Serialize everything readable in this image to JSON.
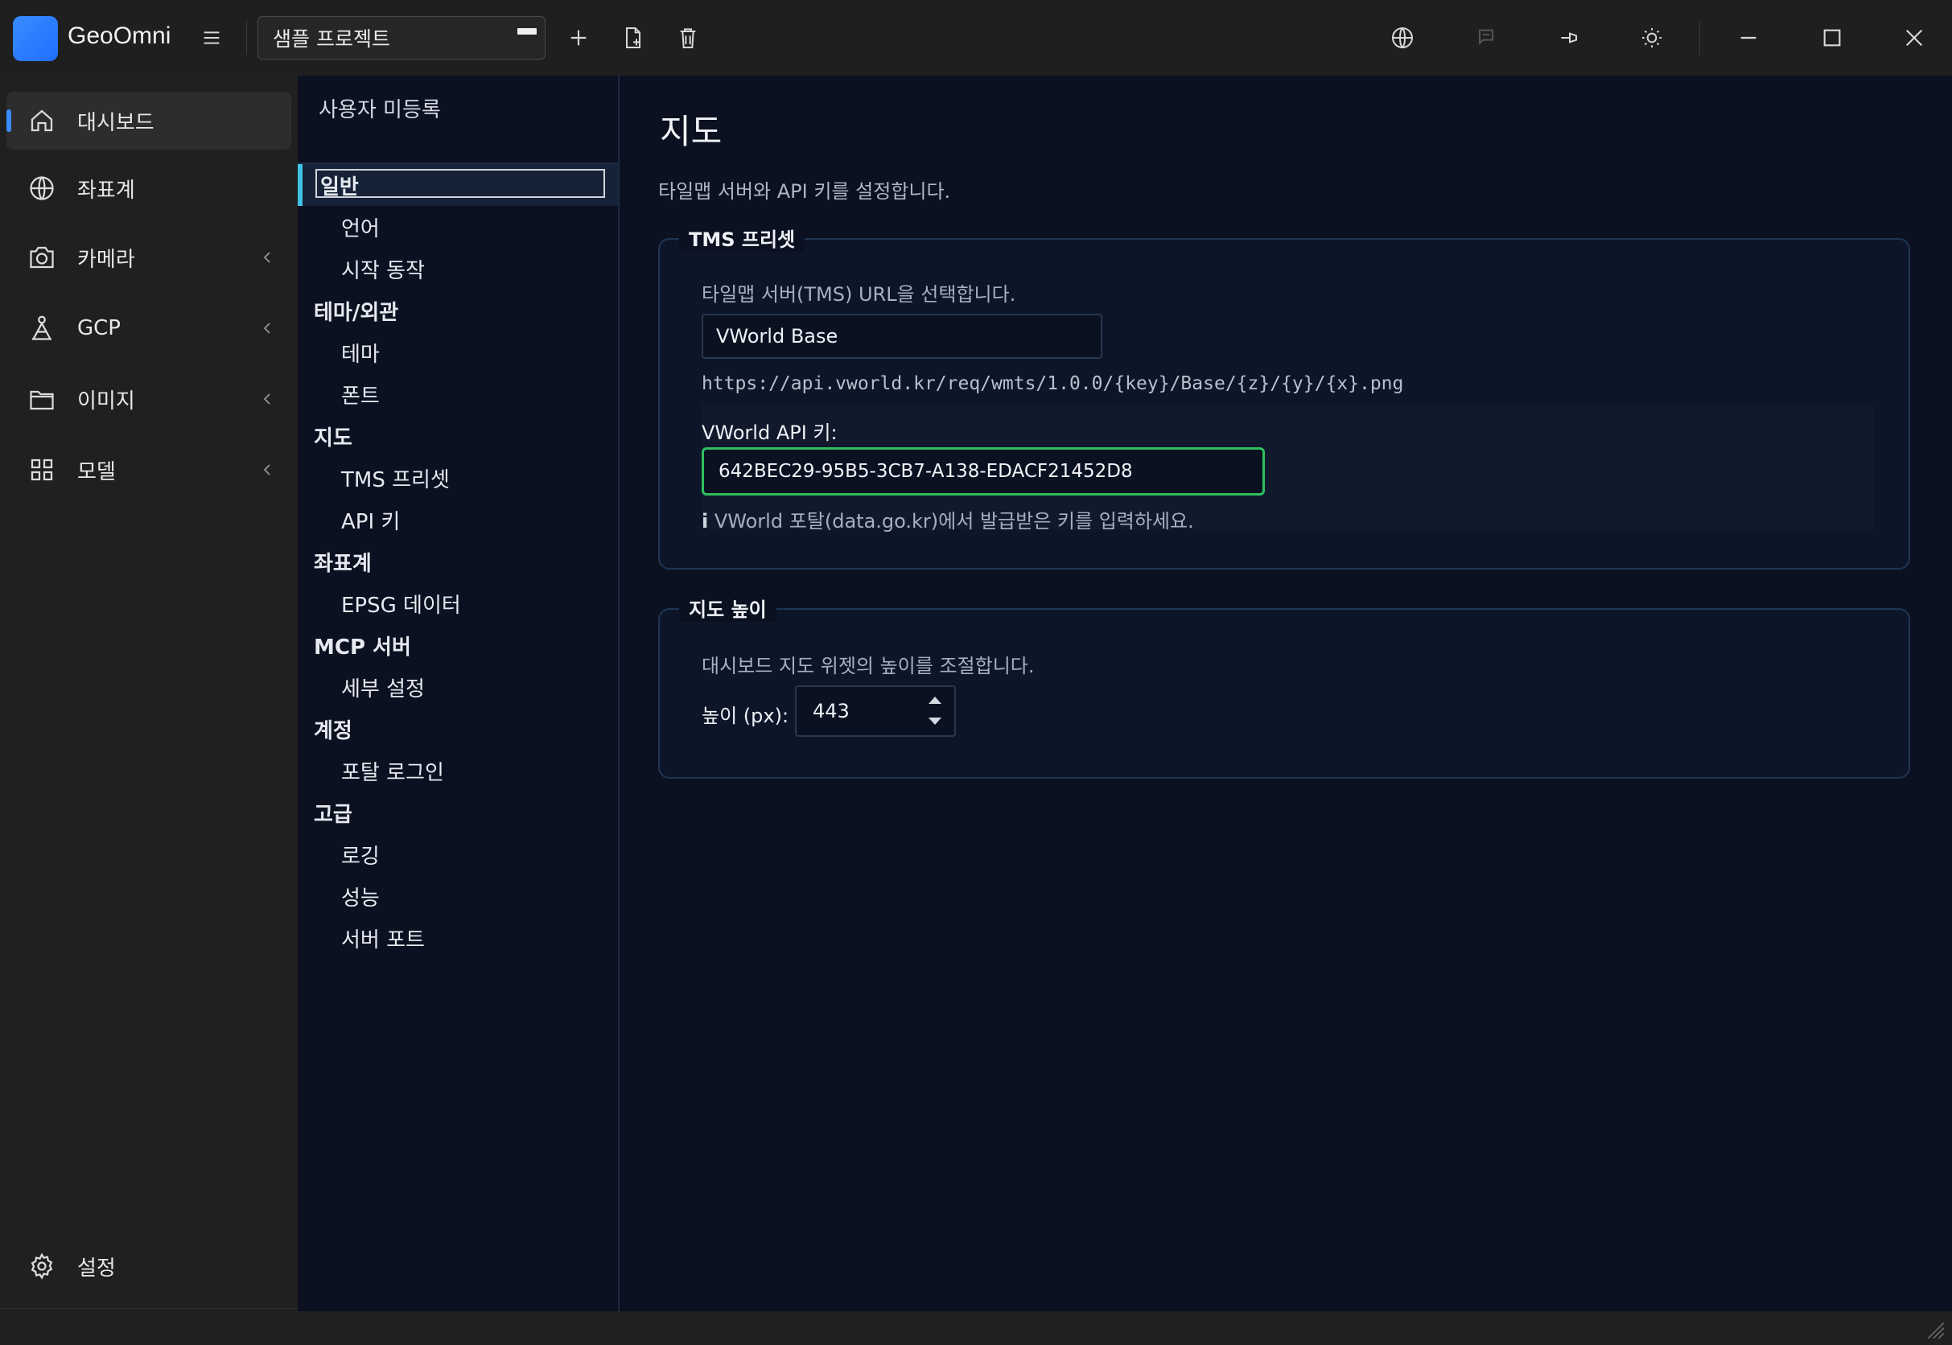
{
  "app": {
    "name": "GeoOmni"
  },
  "titlebar": {
    "project_name": "샘플 프로젝트",
    "icons": [
      "menu-icon",
      "add-icon",
      "new-file-icon",
      "delete-icon",
      "globe-icon",
      "disabled-tool-icon",
      "pin-icon",
      "theme-sun-icon",
      "minimize-icon",
      "maximize-icon",
      "close-icon"
    ]
  },
  "sidebar": {
    "items": [
      {
        "label": "대시보드",
        "icon": "home-icon",
        "active": true,
        "expandable": false
      },
      {
        "label": "좌표계",
        "icon": "globe-icon",
        "active": false,
        "expandable": false
      },
      {
        "label": "카메라",
        "icon": "camera-icon",
        "active": false,
        "expandable": true
      },
      {
        "label": "GCP",
        "icon": "gcp-marker-icon",
        "active": false,
        "expandable": true
      },
      {
        "label": "이미지",
        "icon": "folder-icon",
        "active": false,
        "expandable": true
      },
      {
        "label": "모델",
        "icon": "grid-icon",
        "active": false,
        "expandable": true
      }
    ],
    "settings_label": "설정"
  },
  "settings_tree": {
    "title": "사용자 미등록",
    "groups": [
      {
        "label": "일반",
        "children": [
          "언어",
          "시작 동작"
        ]
      },
      {
        "label": "테마/외관",
        "children": [
          "테마",
          "폰트"
        ]
      },
      {
        "label": "지도",
        "children": [
          "TMS 프리셋",
          "API 키"
        ]
      },
      {
        "label": "좌표계",
        "children": [
          "EPSG 데이터"
        ]
      },
      {
        "label": "MCP 서버",
        "children": [
          "세부 설정"
        ]
      },
      {
        "label": "계정",
        "children": [
          "포탈 로그인"
        ]
      },
      {
        "label": "고급",
        "children": [
          "로깅",
          "성능",
          "서버 포트"
        ]
      }
    ],
    "selected": "일반"
  },
  "main": {
    "title": "지도",
    "description": "타일맵 서버와 API 키를 설정합니다.",
    "tms": {
      "legend": "TMS 프리셋",
      "description": "타일맵 서버(TMS) URL을 선택합니다.",
      "selected": "VWorld Base",
      "url": "https://api.vworld.kr/req/wmts/1.0.0/{key}/Base/{z}/{y}/{x}.png",
      "api_label": "VWorld API 키:",
      "api_key": "642BEC29-95B5-3CB7-A138-EDACF21452D8",
      "api_hint_icon": "i",
      "api_hint": "VWorld 포탈(data.go.kr)에서 발급받은 키를 입력하세요."
    },
    "height": {
      "legend": "지도 높이",
      "description": "대시보드 지도 위젯의 높이를 조절합니다.",
      "label": "높이 (px):",
      "value": "443"
    }
  },
  "colors": {
    "accent": "#3a8cff",
    "selection": "#3fc3e6",
    "focus": "#2fbf5e",
    "panel_bg": "#0b1120"
  }
}
